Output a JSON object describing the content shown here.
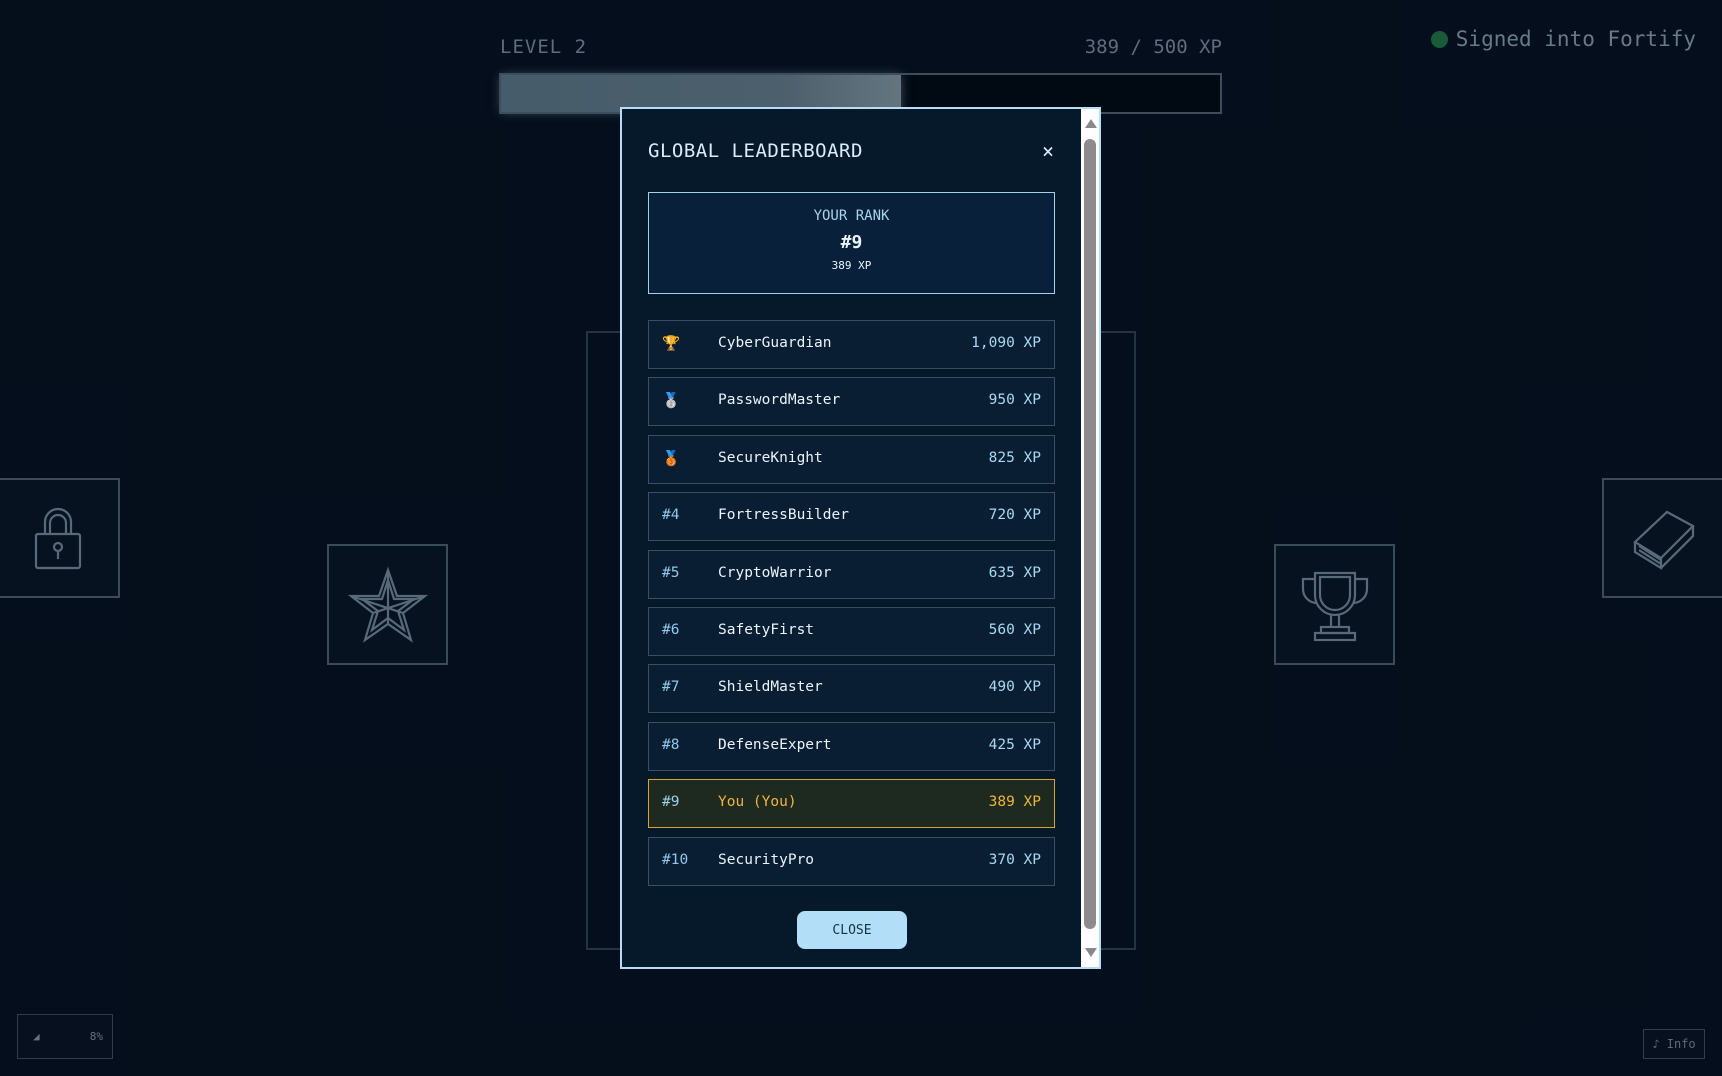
{
  "hud": {
    "level_label": "LEVEL 2",
    "xp_text": "389 / 500 XP",
    "xp_progress": 0.556,
    "signed_in_text": "Signed into Fortify",
    "signed_in_color": "#1f6e43"
  },
  "tiles": {
    "lock": "lock-icon",
    "star": "star-icon",
    "trophy": "trophy-icon",
    "book": "book-icon"
  },
  "volume": {
    "icon": "speaker-icon",
    "level": "8%"
  },
  "info": {
    "icon": "music-note-icon",
    "label": "♪ Info"
  },
  "modal": {
    "title": "GLOBAL LEADERBOARD",
    "close_glyph": "×",
    "your_rank": {
      "label": "YOUR RANK",
      "rank": "#9",
      "xp": "389 XP"
    },
    "entries": [
      {
        "rank": "🏆",
        "name": "CyberGuardian",
        "xp": "1,090 XP"
      },
      {
        "rank": "🥈",
        "name": "PasswordMaster",
        "xp": "950 XP"
      },
      {
        "rank": "🥉",
        "name": "SecureKnight",
        "xp": "825 XP"
      },
      {
        "rank": "#4",
        "name": "FortressBuilder",
        "xp": "720 XP"
      },
      {
        "rank": "#5",
        "name": "CryptoWarrior",
        "xp": "635 XP"
      },
      {
        "rank": "#6",
        "name": "SafetyFirst",
        "xp": "560 XP"
      },
      {
        "rank": "#7",
        "name": "ShieldMaster",
        "xp": "490 XP"
      },
      {
        "rank": "#8",
        "name": "DefenseExpert",
        "xp": "425 XP"
      },
      {
        "rank": "#9",
        "name": "You (You)",
        "xp": "389 XP"
      },
      {
        "rank": "#10",
        "name": "SecurityPro",
        "xp": "370 XP"
      }
    ],
    "highlight_color": "#f0b53a",
    "close_button": "CLOSE"
  }
}
